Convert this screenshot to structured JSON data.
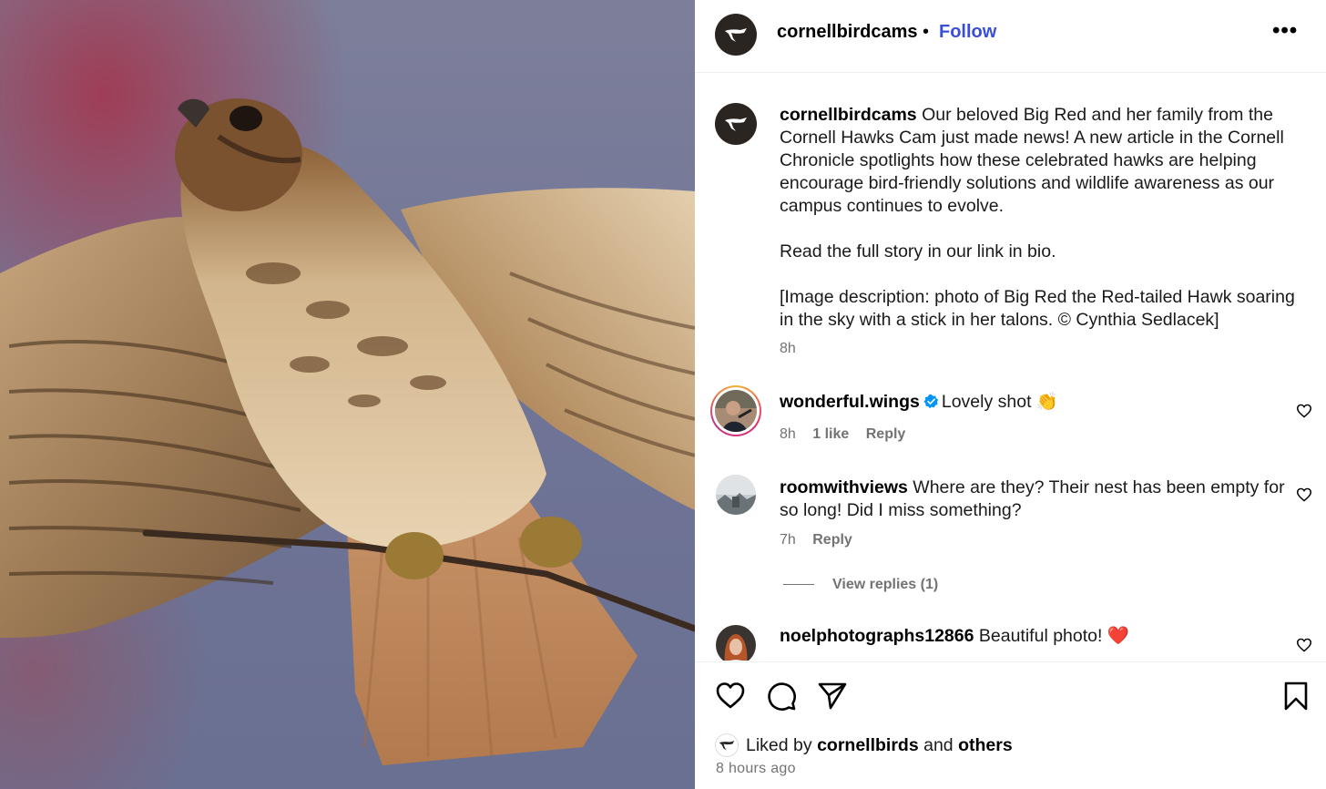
{
  "post": {
    "author": "cornellbirdcams",
    "follow_label": "Follow",
    "separator": "•",
    "more_label": "•••",
    "photo_alt": "Big Red the Red-tailed Hawk soaring with a stick in her talons"
  },
  "caption": {
    "username": "cornellbirdcams",
    "paragraph1": "Our beloved Big Red and her family from the Cornell Hawks Cam just made news! A new article in the Cornell Chronicle spotlights how these celebrated hawks are helping encourage bird-friendly solutions and wildlife awareness as our campus continues to evolve.",
    "paragraph2": "Read the full story in our link in bio.",
    "paragraph3": "[Image description: photo of Big Red the Red-tailed Hawk soaring in the sky with a stick in her talons. © Cynthia Sedlacek]",
    "time": "8h"
  },
  "comments": [
    {
      "username": "wonderful.wings",
      "verified": true,
      "text": "Lovely shot 👏",
      "time": "8h",
      "likes": "1 like",
      "reply_label": "Reply"
    },
    {
      "username": "roomwithviews",
      "verified": false,
      "text": "Where are they? Their nest has been empty for so long! Did I miss something?",
      "time": "7h",
      "reply_label": "Reply",
      "view_replies": "View replies (1)"
    },
    {
      "username": "noelphotographs12866",
      "verified": false,
      "text": "Beautiful photo! ❤️"
    }
  ],
  "footer": {
    "liked_prefix": "Liked by",
    "liked_user": "cornellbirds",
    "liked_and": "and",
    "liked_others": "others",
    "time_ago": "8 hours ago"
  },
  "colors": {
    "follow": "#3a4ed9",
    "secondary_text": "#737373",
    "brand_avatar": "#2b2522",
    "verified_badge": "#0095f6"
  }
}
